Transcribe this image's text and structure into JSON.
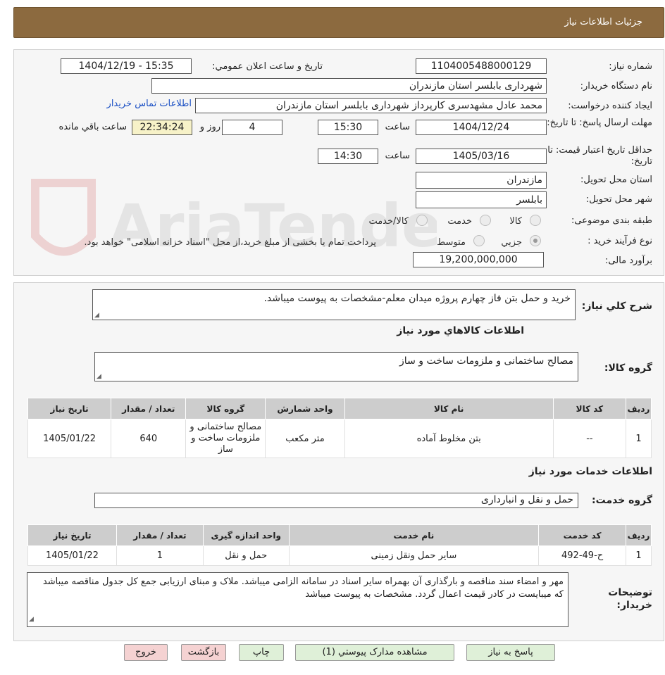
{
  "header": {
    "title": "جزئیات اطلاعات نیاز"
  },
  "form": {
    "need_number_label": "شماره نیاز:",
    "need_number": "1104005488000129",
    "announce_label": "تاریخ و ساعت اعلان عمومي:",
    "announce_value": "1404/12/19 - 15:35",
    "buyer_org_label": "نام دستگاه خريدار:",
    "buyer_org": "شهرداری بابلسر استان مازندران",
    "creator_label": "ايجاد کننده درخواست:",
    "creator": "محمد عادل مشهدسری کارپرداز شهرداری بابلسر استان مازندران",
    "contact_link": "اطلاعات تماس خريدار",
    "deadline_label": "مهلت ارسال پاسخ: تا تاريخ:",
    "deadline_date": "1404/12/24",
    "time_label": "ساعت",
    "deadline_time": "15:30",
    "days_value": "4",
    "days_label": "روز و",
    "remaining_time": "22:34:24",
    "remaining_label": "ساعت باقي مانده",
    "validity_label": "حداقل تاريخ اعتبار قيمت: تا تاريخ:",
    "validity_date": "1405/03/16",
    "validity_time": "14:30",
    "province_label": "استان محل تحويل:",
    "province": "مازندران",
    "city_label": "شهر محل تحويل:",
    "city": "بابلسر",
    "category_label": "طبقه بندی موضوعی:",
    "category_options": [
      "کالا",
      "خدمت",
      "کالا/خدمت"
    ],
    "process_label": "نوع فرآيند خريد :",
    "process_options": [
      "جزيي",
      "متوسط"
    ],
    "process_note": "پرداخت تمام يا بخشی از مبلغ خريد،از محل \"اسناد خزانه اسلامی\" خواهد بود.",
    "budget_label": "برآورد مالی:",
    "budget": "19,200,000,000"
  },
  "summary": {
    "label": "شرح کلي نياز:",
    "text": "خرید و حمل بتن فاز چهارم پروژه میدان معلم-مشخصات به پیوست میباشد."
  },
  "goods": {
    "section_title": "اطلاعات کالاهاي مورد نياز",
    "group_label": "گروه کالا:",
    "group_value": "مصالح ساختمانی و ملزومات ساخت و ساز",
    "columns": [
      "رديف",
      "کد کالا",
      "نام کالا",
      "واحد شمارش",
      "گروه کالا",
      "تعداد / مقدار",
      "تاريخ نياز"
    ],
    "rows": [
      [
        "1",
        "--",
        "بتن مخلوط آماده",
        "متر مکعب",
        "مصالح ساختمانی و ملزومات ساخت و ساز",
        "640",
        "1405/01/22"
      ]
    ]
  },
  "services": {
    "section_title": "اطلاعات خدمات مورد نياز",
    "group_label": "گروه خدمت:",
    "group_value": "حمل و نقل و انبارداری",
    "columns": [
      "رديف",
      "کد خدمت",
      "نام خدمت",
      "واحد اندازه گيری",
      "تعداد / مقدار",
      "تاريخ نياز"
    ],
    "rows": [
      [
        "1",
        "ح-49-492",
        "سایر حمل ونقل زمینی",
        "حمل و نقل",
        "1",
        "1405/01/22"
      ]
    ]
  },
  "notes": {
    "label": "توضيحات خريدار:",
    "text": "مهر و امضاء سند مناقصه و بارگذاری آن بهمراه سایر اسناد در سامانه الزامی میباشد. ملاک و مبنای ارزیابی جمع کل جدول مناقصه میباشد که میبایست در کادر قیمت اعمال گردد. مشخصات به پیوست میباشد"
  },
  "buttons": {
    "reply": "پاسخ به نياز",
    "attachments": "مشاهده مدارک پيوستي (1)",
    "print": "چاپ",
    "back": "بازگشت",
    "exit": "خروج"
  },
  "watermark": {
    "text": "AriaTender.neT"
  },
  "colors": {
    "header_bg": "#8c6a3f",
    "table_header": "#cdcdcd",
    "link": "#1a4fc4",
    "green_btn": "#dff0d8",
    "pink_btn": "#f5d2d2"
  }
}
